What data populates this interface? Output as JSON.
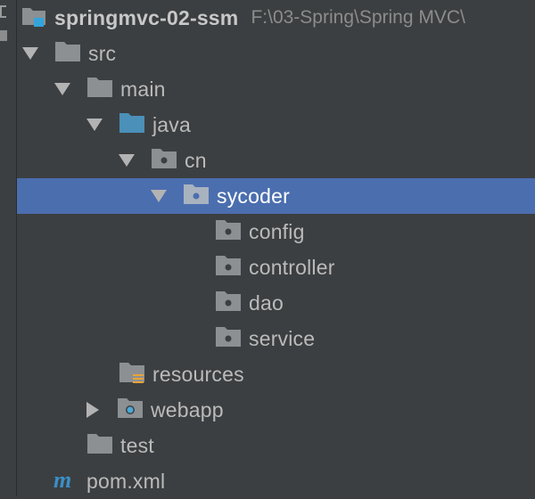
{
  "project": {
    "name": "springmvc-02-ssm",
    "path": "F:\\03-Spring\\Spring MVC\\"
  },
  "tree": [
    {
      "label": "src"
    },
    {
      "label": "main"
    },
    {
      "label": "java"
    },
    {
      "label": "cn"
    },
    {
      "label": "sycoder"
    },
    {
      "label": "config"
    },
    {
      "label": "controller"
    },
    {
      "label": "dao"
    },
    {
      "label": "service"
    },
    {
      "label": "resources"
    },
    {
      "label": "webapp"
    },
    {
      "label": "test"
    },
    {
      "label": "pom.xml"
    }
  ],
  "icons": {
    "folder": "folder-icon",
    "source_root": "source-root-folder-icon",
    "package": "package-icon",
    "resources": "resources-folder-icon",
    "web": "web-folder-icon",
    "maven": "maven-icon"
  },
  "colors": {
    "background": "#3c3f41",
    "selection": "#4b6eaf",
    "folder": "#8c9092",
    "source_root": "#4a90b8",
    "maven": "#3a8fc9"
  },
  "selected": "sycoder"
}
